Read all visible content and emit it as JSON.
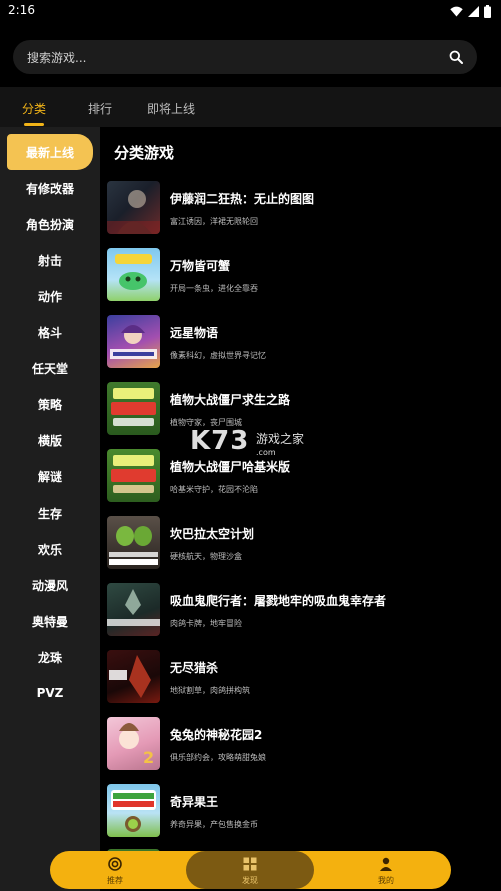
{
  "status_bar": {
    "time": "2:16"
  },
  "search": {
    "placeholder": "搜索游戏..."
  },
  "tabs": [
    {
      "label": "分类",
      "active": true
    },
    {
      "label": "排行",
      "active": false
    },
    {
      "label": "即将上线",
      "active": false
    }
  ],
  "sidebar": {
    "items": [
      {
        "label": "最新上线",
        "active": true
      },
      {
        "label": "有修改器"
      },
      {
        "label": "角色扮演"
      },
      {
        "label": "射击"
      },
      {
        "label": "动作"
      },
      {
        "label": "格斗"
      },
      {
        "label": "任天堂"
      },
      {
        "label": "策略"
      },
      {
        "label": "横版"
      },
      {
        "label": "解谜"
      },
      {
        "label": "生存"
      },
      {
        "label": "欢乐"
      },
      {
        "label": "动漫风"
      },
      {
        "label": "奥特曼"
      },
      {
        "label": "龙珠"
      },
      {
        "label": "PVZ"
      }
    ]
  },
  "content": {
    "section_title": "分类游戏",
    "games": [
      {
        "title": "伊藤润二狂热：无止的图图",
        "desc": "富江诱因，洋裙无限轮回"
      },
      {
        "title": "万物皆可蟹",
        "desc": "开局一条虫，进化全靠吞"
      },
      {
        "title": "远星物语",
        "desc": "像素科幻，虚拟世界寻记忆"
      },
      {
        "title": "植物大战僵尸求生之路",
        "desc": "植物守家，丧尸围城"
      },
      {
        "title": "植物大战僵尸哈基米版",
        "desc": "哈基米守护，花园不沦陷"
      },
      {
        "title": "坎巴拉太空计划",
        "desc": "硬核航天，物理沙盒"
      },
      {
        "title": "吸血鬼爬行者：屠戮地牢的吸血鬼幸存者",
        "desc": "肉鸽卡牌，地牢冒险"
      },
      {
        "title": "无尽猎杀",
        "desc": "地狱割草，肉鸽拼构筑"
      },
      {
        "title": "兔兔的神秘花园2",
        "desc": "俱乐部约会，攻略萌甜兔娘"
      },
      {
        "title": "奇异果王",
        "desc": "养奇异果，产包售换金币"
      }
    ]
  },
  "watermark": {
    "big": "K73",
    "small": "游戏之家",
    "url": ".com"
  },
  "bottom_nav": [
    {
      "label": "推荐",
      "icon": "target-icon",
      "active": false
    },
    {
      "label": "发现",
      "icon": "grid-icon",
      "active": true
    },
    {
      "label": "我的",
      "icon": "person-icon",
      "active": false
    }
  ],
  "colors": {
    "accent": "#f2b418",
    "sidebar_active": "#f4c352",
    "nav_bg": "#f4b10f"
  }
}
